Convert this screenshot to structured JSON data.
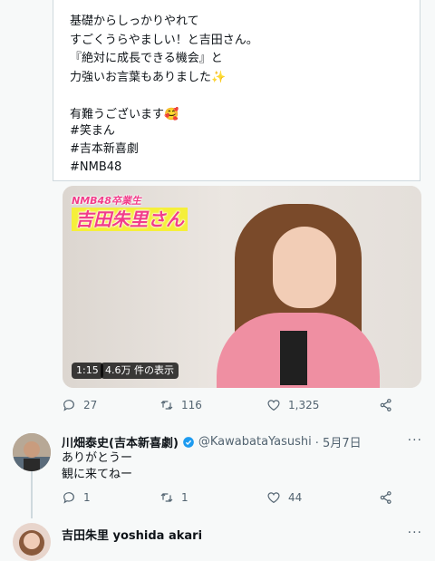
{
  "tweet": {
    "lines": "基礎からしっかりやれて\nすごくうらやましい！と吉田さん。\n『絶対に成長できる機会』と\n力強いお言葉もありました✨\n\n有難うございます🥰",
    "hashtags": [
      "#笑まん",
      "#吉本新喜劇",
      "#NMB48"
    ]
  },
  "video": {
    "overlay_small": "NMB48卒業生",
    "overlay_big": "吉田朱里さん",
    "duration": "1:15",
    "views": "4.6万 件の表示"
  },
  "tweet_actions": {
    "replies": "27",
    "retweets": "116",
    "likes": "1,325"
  },
  "reply1": {
    "name": "川畑泰史(吉本新喜劇)",
    "handle": "@KawabataYasushi",
    "date": "· 5月7日",
    "more": "···",
    "text": "ありがとうー\n観に来てねー",
    "replies": "1",
    "retweets": "1",
    "likes": "44"
  },
  "reply2": {
    "name": "吉田朱里 yoshida akari",
    "more": "···"
  },
  "colors": {
    "verified": "#1d9bf0",
    "text_secondary": "#536471",
    "tag_pink": "#f23c8a",
    "tag_yellow": "#f5ef3a"
  }
}
